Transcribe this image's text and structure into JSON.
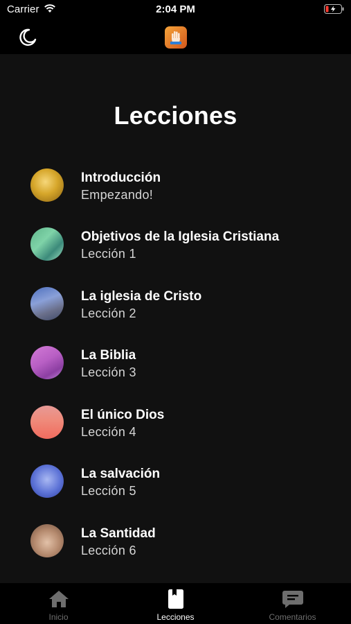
{
  "status_bar": {
    "carrier": "Carrier",
    "time": "2:04 PM"
  },
  "nav_bar": {
    "left_icon": "moon-icon",
    "center_icon": "app-logo"
  },
  "page": {
    "title": "Lecciones"
  },
  "lessons": [
    {
      "title": "Introducción",
      "subtitle": "Empezando!"
    },
    {
      "title": "Objetivos de la Iglesia Cristiana",
      "subtitle": "Lección 1"
    },
    {
      "title": "La iglesia de Cristo",
      "subtitle": "Lección 2"
    },
    {
      "title": "La Biblia",
      "subtitle": "Lección 3"
    },
    {
      "title": "El único Dios",
      "subtitle": "Lección 4"
    },
    {
      "title": "La salvación",
      "subtitle": "Lección 5"
    },
    {
      "title": "La Santidad",
      "subtitle": "Lección 6"
    }
  ],
  "tabs": [
    {
      "label": "Inicio",
      "icon": "home-icon",
      "active": false
    },
    {
      "label": "Lecciones",
      "icon": "book-icon",
      "active": true
    },
    {
      "label": "Comentarios",
      "icon": "chat-icon",
      "active": false
    }
  ],
  "colors": {
    "background": "#111111",
    "bars": "#000000",
    "tab_inactive": "#6e6e6e"
  }
}
